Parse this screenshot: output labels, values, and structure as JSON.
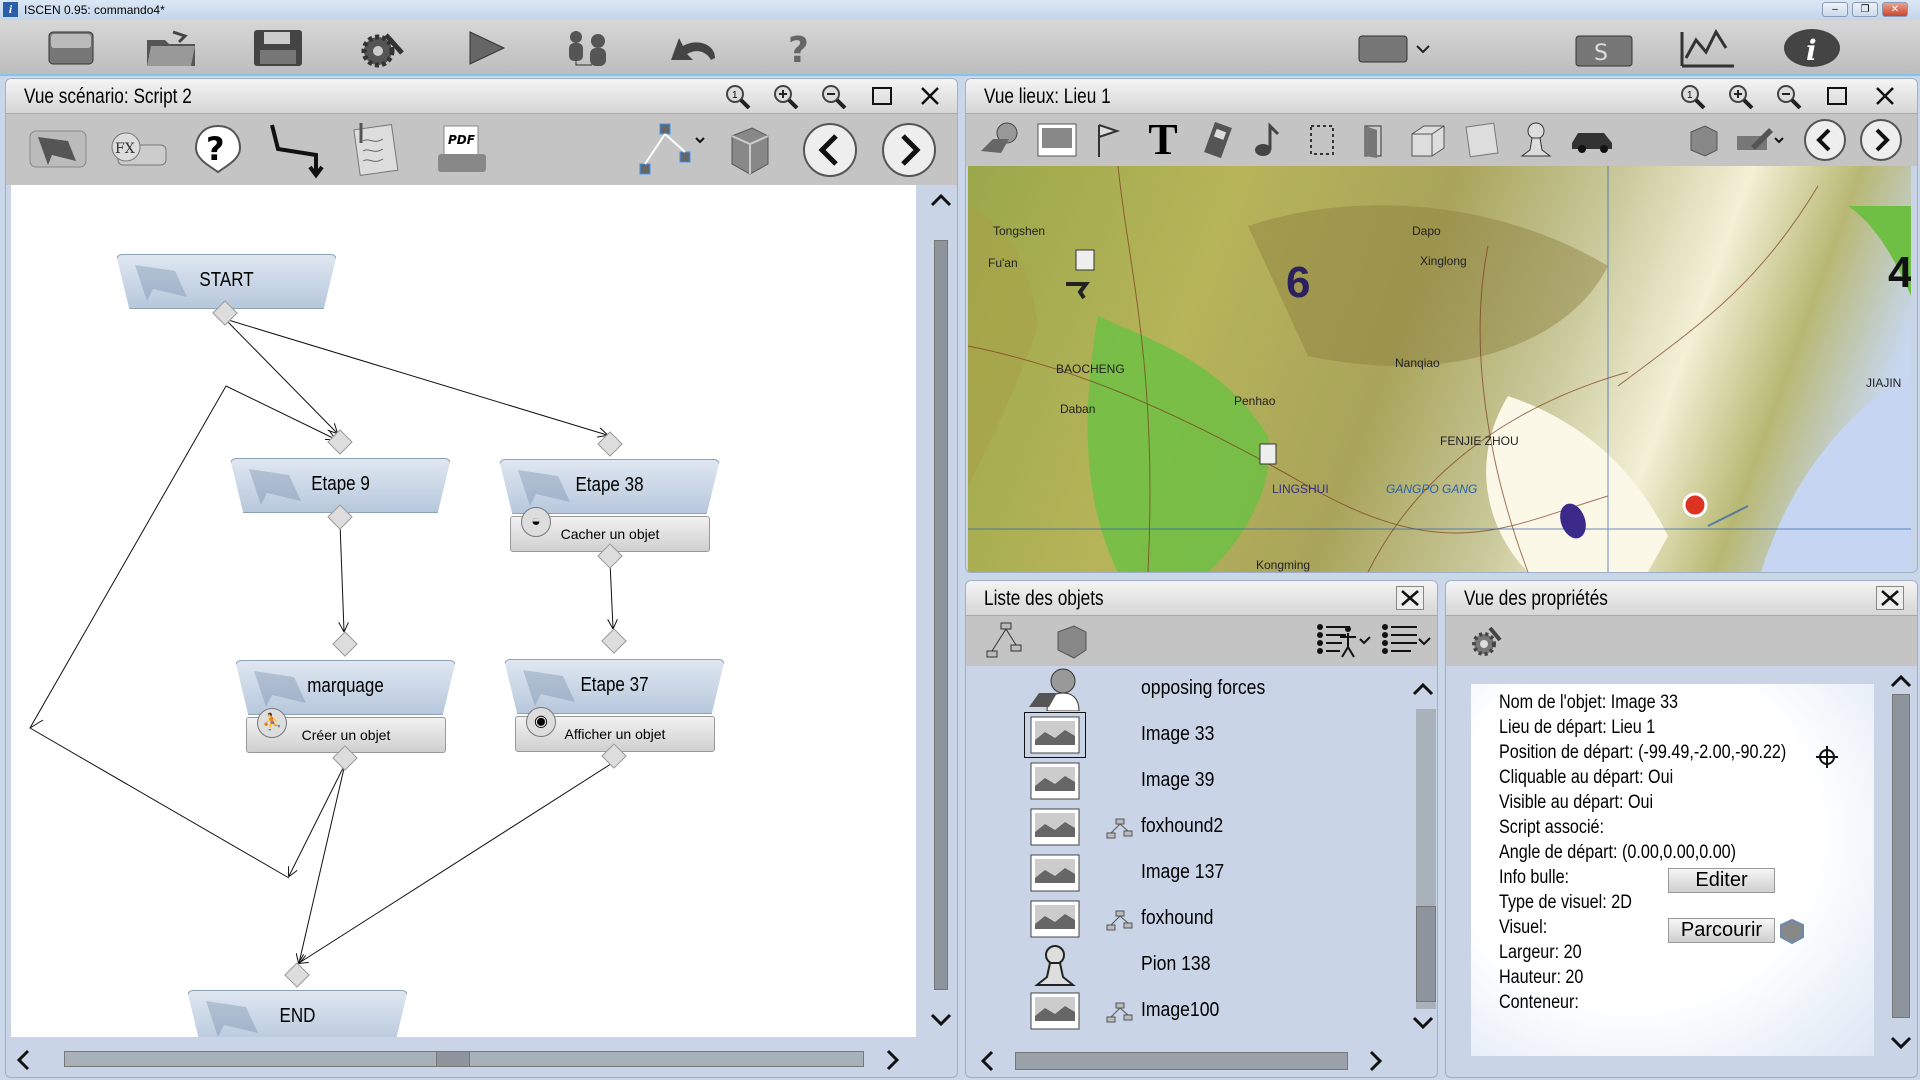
{
  "window": {
    "title": "ISCEN 0.95: commando4*",
    "minimize": "–",
    "maximize": "❐",
    "close": "✕"
  },
  "toolbar": {
    "items": [
      "new-document",
      "open-folder",
      "save",
      "settings",
      "play",
      "users",
      "undo",
      "help"
    ],
    "right": [
      "screen-dropdown",
      "export",
      "statistics",
      "info"
    ]
  },
  "scenario": {
    "title": "Vue scénario: Script 2",
    "header_buttons": [
      "zoom-reset",
      "zoom-in",
      "zoom-out",
      "maximize",
      "close"
    ],
    "tools": [
      "flag",
      "fx",
      "question",
      "connector",
      "notes",
      "pdf",
      "tree",
      "cube",
      "prev",
      "next"
    ],
    "pdf_label": "PDF",
    "fx_label": "FX",
    "nodes": {
      "start": {
        "label": "START"
      },
      "etape9": {
        "label": "Etape 9"
      },
      "etape38": {
        "label": "Etape 38",
        "action": "Cacher un objet"
      },
      "marquage": {
        "label": "marquage",
        "action": "Créer un objet"
      },
      "etape37": {
        "label": "Etape 37",
        "action": "Afficher un objet"
      },
      "end": {
        "label": "END"
      }
    }
  },
  "places": {
    "title": "Vue lieux: Lieu 1",
    "tools": [
      "person",
      "image",
      "flag",
      "text",
      "film",
      "music",
      "selection",
      "door",
      "box",
      "notes",
      "pawn",
      "car",
      "cube",
      "pencil",
      "prev",
      "next"
    ],
    "text_tool": "T",
    "map_labels": [
      "Tongshen",
      "Fu'an",
      "BAOCHENG",
      "Daban",
      "Penhao",
      "LINGSHUI",
      "Kongming",
      "Dapo",
      "Xinglong",
      "Nanqiao",
      "JIAJIN",
      "FENJIE ZHOU",
      "GANGPO GANG",
      "6",
      "4"
    ]
  },
  "objects": {
    "title": "Liste des objets",
    "items": [
      {
        "label": "opposing forces",
        "icon": "user-laptop",
        "tree": false
      },
      {
        "label": "Image 33",
        "icon": "image",
        "tree": false,
        "selected": true
      },
      {
        "label": "Image 39",
        "icon": "image",
        "tree": false
      },
      {
        "label": "foxhound2",
        "icon": "image",
        "tree": true
      },
      {
        "label": "Image 137",
        "icon": "image",
        "tree": false
      },
      {
        "label": "foxhound",
        "icon": "image",
        "tree": true
      },
      {
        "label": "Pion 138",
        "icon": "pawn",
        "tree": false
      },
      {
        "label": "Image100",
        "icon": "image",
        "tree": true
      }
    ]
  },
  "properties": {
    "title": "Vue des propriétés",
    "rows": [
      "Nom de l'objet: Image 33",
      "Lieu de départ: Lieu 1",
      "Position de départ: (-99.49,-2.00,-90.22)",
      "Cliquable au départ: Oui",
      "Visible au départ: Oui",
      "Script associé:",
      "Angle de départ: (0.00,0.00,0.00)",
      "Info bulle:",
      "Type de visuel: 2D",
      "Visuel:",
      "Largeur: 20",
      "Hauteur: 20",
      "Conteneur:"
    ],
    "edit_button": "Editer",
    "browse_button": "Parcourir"
  }
}
